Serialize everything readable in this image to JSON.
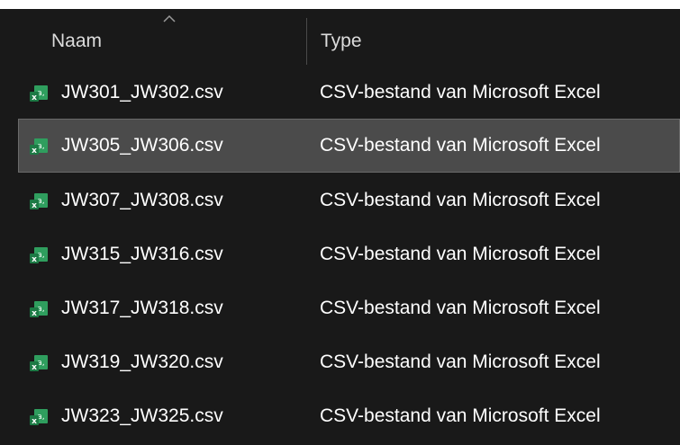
{
  "header": {
    "columns": [
      {
        "label": "Naam",
        "sorted": "ascending"
      },
      {
        "label": "Type"
      }
    ]
  },
  "files": [
    {
      "name": "JW301_JW302.csv",
      "type": "CSV-bestand van Microsoft Excel",
      "icon": "excel-csv-icon",
      "selected": false
    },
    {
      "name": "JW305_JW306.csv",
      "type": "CSV-bestand van Microsoft Excel",
      "icon": "excel-csv-icon",
      "selected": true
    },
    {
      "name": "JW307_JW308.csv",
      "type": "CSV-bestand van Microsoft Excel",
      "icon": "excel-csv-icon",
      "selected": false
    },
    {
      "name": "JW315_JW316.csv",
      "type": "CSV-bestand van Microsoft Excel",
      "icon": "excel-csv-icon",
      "selected": false
    },
    {
      "name": "JW317_JW318.csv",
      "type": "CSV-bestand van Microsoft Excel",
      "icon": "excel-csv-icon",
      "selected": false
    },
    {
      "name": "JW319_JW320.csv",
      "type": "CSV-bestand van Microsoft Excel",
      "icon": "excel-csv-icon",
      "selected": false
    },
    {
      "name": "JW323_JW325.csv",
      "type": "CSV-bestand van Microsoft Excel",
      "icon": "excel-csv-icon",
      "selected": false
    }
  ],
  "colors": {
    "background": "#191919",
    "selected_row": "#4b4b4b",
    "text": "#ffffff",
    "excel_green": "#1d7a45"
  }
}
